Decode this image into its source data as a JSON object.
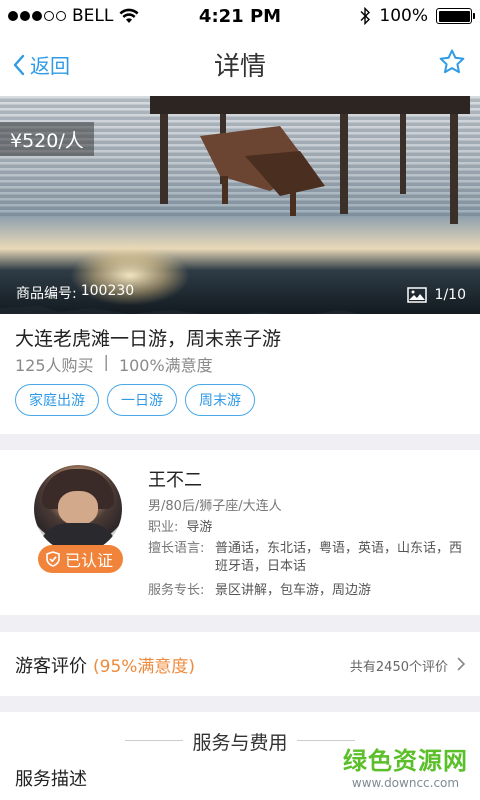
{
  "status_bar": {
    "carrier": "BELL",
    "time": "4:21 PM",
    "battery": "100%"
  },
  "nav": {
    "back_label": "返回",
    "title": "详情"
  },
  "hero": {
    "price": "¥520/人",
    "product_code_label": "商品编号:",
    "product_code": "100230",
    "gallery_count": "1/10"
  },
  "info": {
    "title": "大连老虎滩一日游，周末亲子游",
    "purchases": "125人购买",
    "separator": "|",
    "satisfaction": "100%满意度",
    "tags": [
      "家庭出游",
      "一日游",
      "周末游"
    ]
  },
  "guide": {
    "name": "王不二",
    "verified_label": "已认证",
    "profile": "男/80后/狮子座/大连人",
    "job_label": "职业:",
    "job": "导游",
    "lang_label": "擅长语言:",
    "languages": "普通话，东北话，粤语，英语，山东话，西班牙语，日本话",
    "specialty_label": "服务专长:",
    "specialty": "景区讲解，包车游，周边游"
  },
  "reviews": {
    "title": "游客评价",
    "rate": "(95%满意度)",
    "count": "共有2450个评价"
  },
  "service": {
    "header": "服务与费用",
    "desc_label": "服务描述"
  },
  "watermark": {
    "main": "绿色资源网",
    "sub": "www.downcc.com"
  },
  "colors": {
    "accent": "#2f9be6",
    "orange": "#f2833a",
    "watermark_green": "#5bbf2a"
  }
}
